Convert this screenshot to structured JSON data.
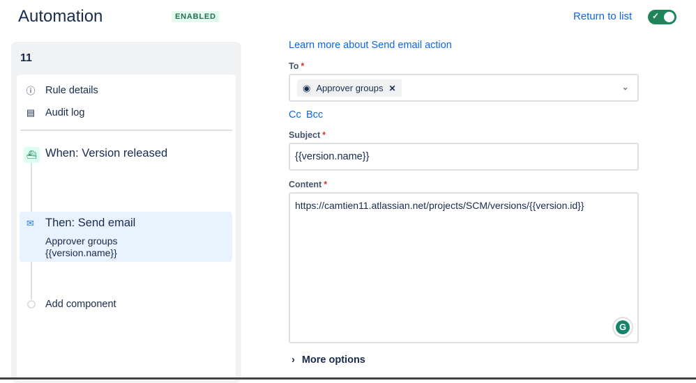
{
  "header": {
    "title": "Automation",
    "status_badge": "ENABLED",
    "return_link": "Return to list",
    "toggle_on": true
  },
  "sidebar": {
    "rule_number": "11",
    "items": [
      {
        "label": "Rule details",
        "icon": "info-icon"
      },
      {
        "label": "Audit log",
        "icon": "document-icon"
      }
    ],
    "trigger": {
      "label": "When: Version released",
      "icon": "ship-icon"
    },
    "action": {
      "title": "Then: Send email",
      "line1": "Approver groups",
      "line2": "{{version.name}}",
      "icon": "mail-icon"
    },
    "add_component": "Add component"
  },
  "form": {
    "learn_more": "Learn more about Send email action",
    "to_label": "To",
    "to_chip": "Approver groups",
    "cc": "Cc",
    "bcc": "Bcc",
    "subject_label": "Subject",
    "subject_value": "{{version.name}}",
    "content_label": "Content",
    "content_value": "https://camtien11.atlassian.net/projects/SCM/versions/{{version.id}}",
    "more_options": "More options"
  },
  "colors": {
    "accent": "#0c66e4",
    "success": "#1f845a"
  }
}
